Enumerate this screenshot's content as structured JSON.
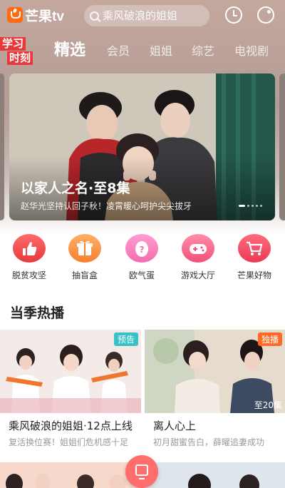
{
  "app": {
    "logo_text": "芒果tv"
  },
  "search": {
    "placeholder": "乘风破浪的姐姐"
  },
  "promo": {
    "line1": "学习",
    "line2": "时刻"
  },
  "tabs": [
    {
      "label": "精选",
      "active": true
    },
    {
      "label": "会员"
    },
    {
      "label": "姐姐"
    },
    {
      "label": "综艺"
    },
    {
      "label": "电视剧"
    }
  ],
  "banner": {
    "title": "以家人之名·至8集",
    "subtitle": "赵华光坚持认回子秋！凌霄暖心呵护尖尖拔牙",
    "page_count": 5,
    "active_index": 0
  },
  "entries": [
    {
      "label": "脱贫攻坚",
      "icon": "thumbs-up-icon",
      "color": "#e63b3b"
    },
    {
      "label": "抽盲盒",
      "icon": "gift-box-icon",
      "color": "#f5802f"
    },
    {
      "label": "欧气蛋",
      "icon": "egg-icon",
      "color": "#f56bb0"
    },
    {
      "label": "游戏大厅",
      "icon": "gamepad-icon",
      "color": "#f0507a"
    },
    {
      "label": "芒果好物",
      "icon": "cart-icon",
      "color": "#ea3a55"
    }
  ],
  "section": {
    "title": "当季热播"
  },
  "cards": [
    {
      "tag": "预告",
      "title": "乘风破浪的姐姐·12点上线",
      "subtitle": "复活换位赛！姐姐们危机感十足",
      "episode": ""
    },
    {
      "tag": "独播",
      "title": "离人心上",
      "subtitle": "初月甜蜜告白，薛曜追妻成功",
      "episode": "至20集"
    }
  ],
  "colors": {
    "brand": "#ff6a14",
    "accent": "#ff6d6d",
    "preview_tag": "#36c2c7",
    "exclusive_tag": "#ff6a28"
  }
}
